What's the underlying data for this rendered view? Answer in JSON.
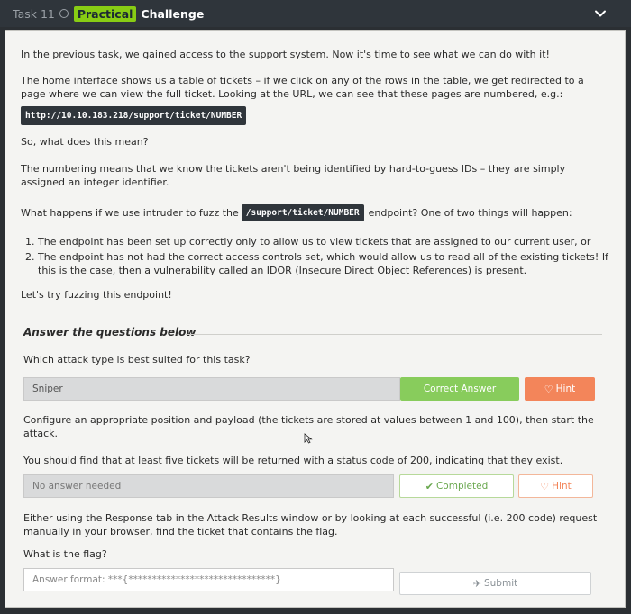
{
  "header": {
    "task_number": "Task 11",
    "practical_label": "Practical",
    "challenge_label": "Challenge"
  },
  "body": {
    "para1": "In the previous task, we gained access to the support system. Now it's time to see what we can do with it!",
    "para2": "The home interface shows us a table of tickets – if we click on any of the rows in the table, we get redirected to a page where we can view the full ticket. Looking at the URL, we can see that these pages are numbered, e.g.:",
    "url_example": "http://10.10.183.218/support/ticket/NUMBER",
    "para3": "So, what does this mean?",
    "para4": "The numbering means that we know the tickets aren't being identified by hard-to-guess IDs – they are simply assigned an integer identifier.",
    "para5_before": "What happens if we use intruder to fuzz the",
    "para5_chip": "/support/ticket/NUMBER",
    "para5_after": "endpoint? One of two things will happen:",
    "list": [
      "The endpoint has been set up correctly only to allow us to view tickets that are assigned to our current user, or",
      "The endpoint has not had the correct access controls set, which would allow us to read all of the existing tickets! If this is the case, then a vulnerability called an IDOR (Insecure Direct Object References) is present."
    ],
    "para6": "Let's try fuzzing this endpoint!"
  },
  "answers": {
    "heading": "Answer the questions below",
    "q1": "Which attack type is best suited for this task?",
    "q1_answer": "Sniper",
    "correct_label": "Correct Answer",
    "hint_label": "Hint",
    "q2": "Configure an appropriate position and payload (the tickets are stored at values between 1 and 100), then start the attack.",
    "q3": "You should find that at least five tickets will be returned with a status code of 200, indicating that they exist.",
    "no_answer": "No answer needed",
    "completed_label": "Completed",
    "q4": "Either using the Response tab in the Attack Results window or by looking at each successful (i.e. 200 code) request manually in your browser, find the ticket that contains the flag.",
    "q5": "What is the flag?",
    "answer_placeholder": "Answer format: ***{*******************************}",
    "submit_label": "Submit"
  },
  "colors": {
    "practical": "#88cc14",
    "correct": "#88cc5c",
    "hint": "#f3855a"
  }
}
